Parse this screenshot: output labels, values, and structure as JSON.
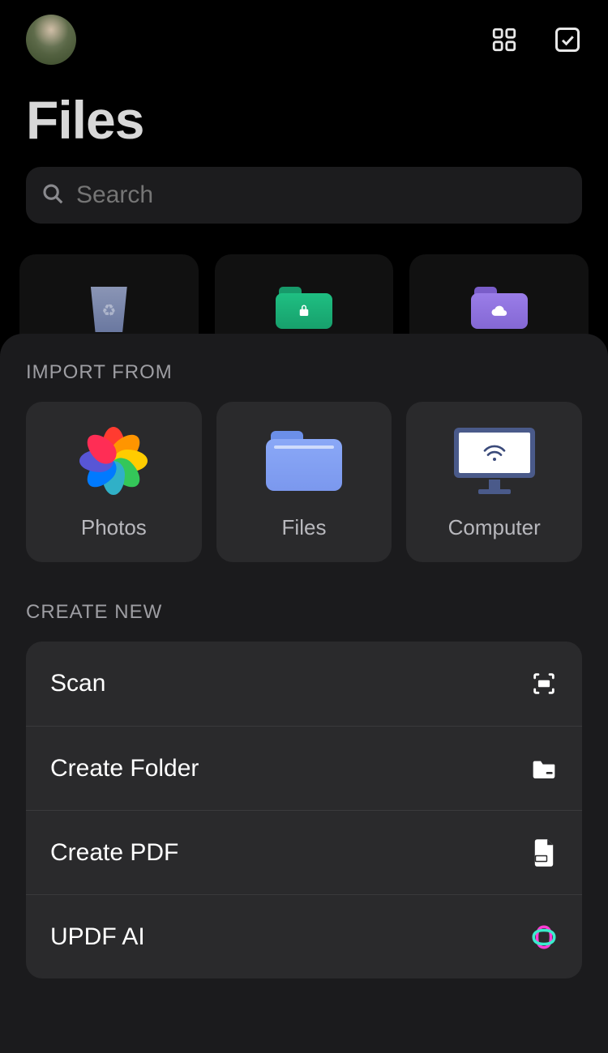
{
  "header": {
    "page_title": "Files"
  },
  "search": {
    "placeholder": "Search"
  },
  "sheet": {
    "import_title": "IMPORT FROM",
    "import_items": [
      {
        "label": "Photos"
      },
      {
        "label": "Files"
      },
      {
        "label": "Computer"
      }
    ],
    "create_title": "CREATE NEW",
    "create_items": [
      {
        "label": "Scan"
      },
      {
        "label": "Create Folder"
      },
      {
        "label": "Create PDF"
      },
      {
        "label": "UPDF AI"
      }
    ]
  }
}
